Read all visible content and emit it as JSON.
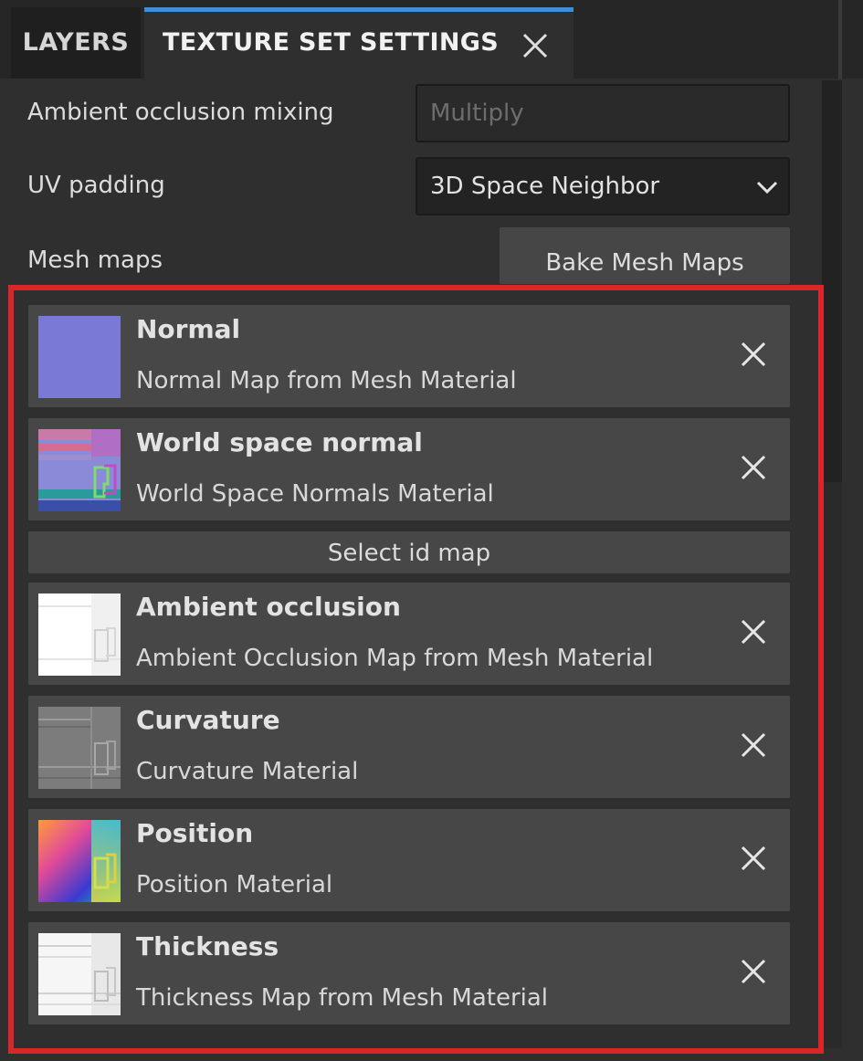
{
  "tabs": {
    "layers": "LAYERS",
    "texture_set_settings": "TEXTURE SET SETTINGS"
  },
  "settings": {
    "ao_mixing": {
      "label": "Ambient occlusion mixing",
      "value": "Multiply"
    },
    "uv_padding": {
      "label": "UV padding",
      "value": "3D Space Neighbor"
    },
    "mesh_maps": {
      "label": "Mesh maps",
      "bake_button": "Bake Mesh Maps"
    }
  },
  "maps": [
    {
      "title": "Normal",
      "subtitle": "Normal Map from Mesh Material",
      "icon": "normal-thumbnail"
    },
    {
      "title": "World space normal",
      "subtitle": "World Space Normals Material",
      "icon": "world-space-normal-thumbnail"
    },
    {
      "title": "Ambient occlusion",
      "subtitle": "Ambient Occlusion Map from Mesh Material",
      "icon": "ambient-occlusion-thumbnail"
    },
    {
      "title": "Curvature",
      "subtitle": "Curvature Material",
      "icon": "curvature-thumbnail"
    },
    {
      "title": "Position",
      "subtitle": "Position Material",
      "icon": "position-thumbnail"
    },
    {
      "title": "Thickness",
      "subtitle": "Thickness Map from Mesh Material",
      "icon": "thickness-thumbnail"
    }
  ],
  "select_id_map": "Select id map",
  "colors": {
    "accent": "#3f8fd6",
    "highlight": "#d8262a",
    "normal": "#7a7ad6"
  }
}
